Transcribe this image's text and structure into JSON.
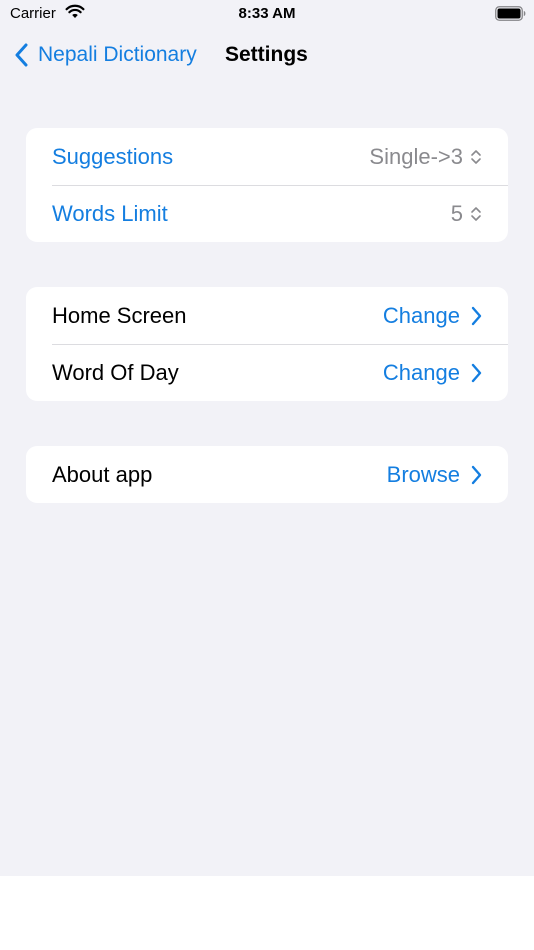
{
  "status_bar": {
    "carrier": "Carrier",
    "time": "8:33 AM"
  },
  "nav": {
    "back_label": "Nepali Dictionary",
    "title": "Settings"
  },
  "groups": [
    {
      "rows": [
        {
          "label": "Suggestions",
          "value": "Single->3",
          "accessory": "updown-icon"
        },
        {
          "label": "Words Limit",
          "value": "5",
          "accessory": "updown-icon"
        }
      ]
    },
    {
      "rows": [
        {
          "label": "Home Screen",
          "value": "Change",
          "accessory": "chevron-right-icon"
        },
        {
          "label": "Word Of Day",
          "value": "Change",
          "accessory": "chevron-right-icon"
        }
      ]
    },
    {
      "rows": [
        {
          "label": "About app",
          "value": "Browse",
          "accessory": "chevron-right-icon"
        }
      ]
    }
  ],
  "colors": {
    "accent": "#147ee0",
    "background": "#f2f2f7",
    "secondary_text": "#8a8a8e"
  }
}
